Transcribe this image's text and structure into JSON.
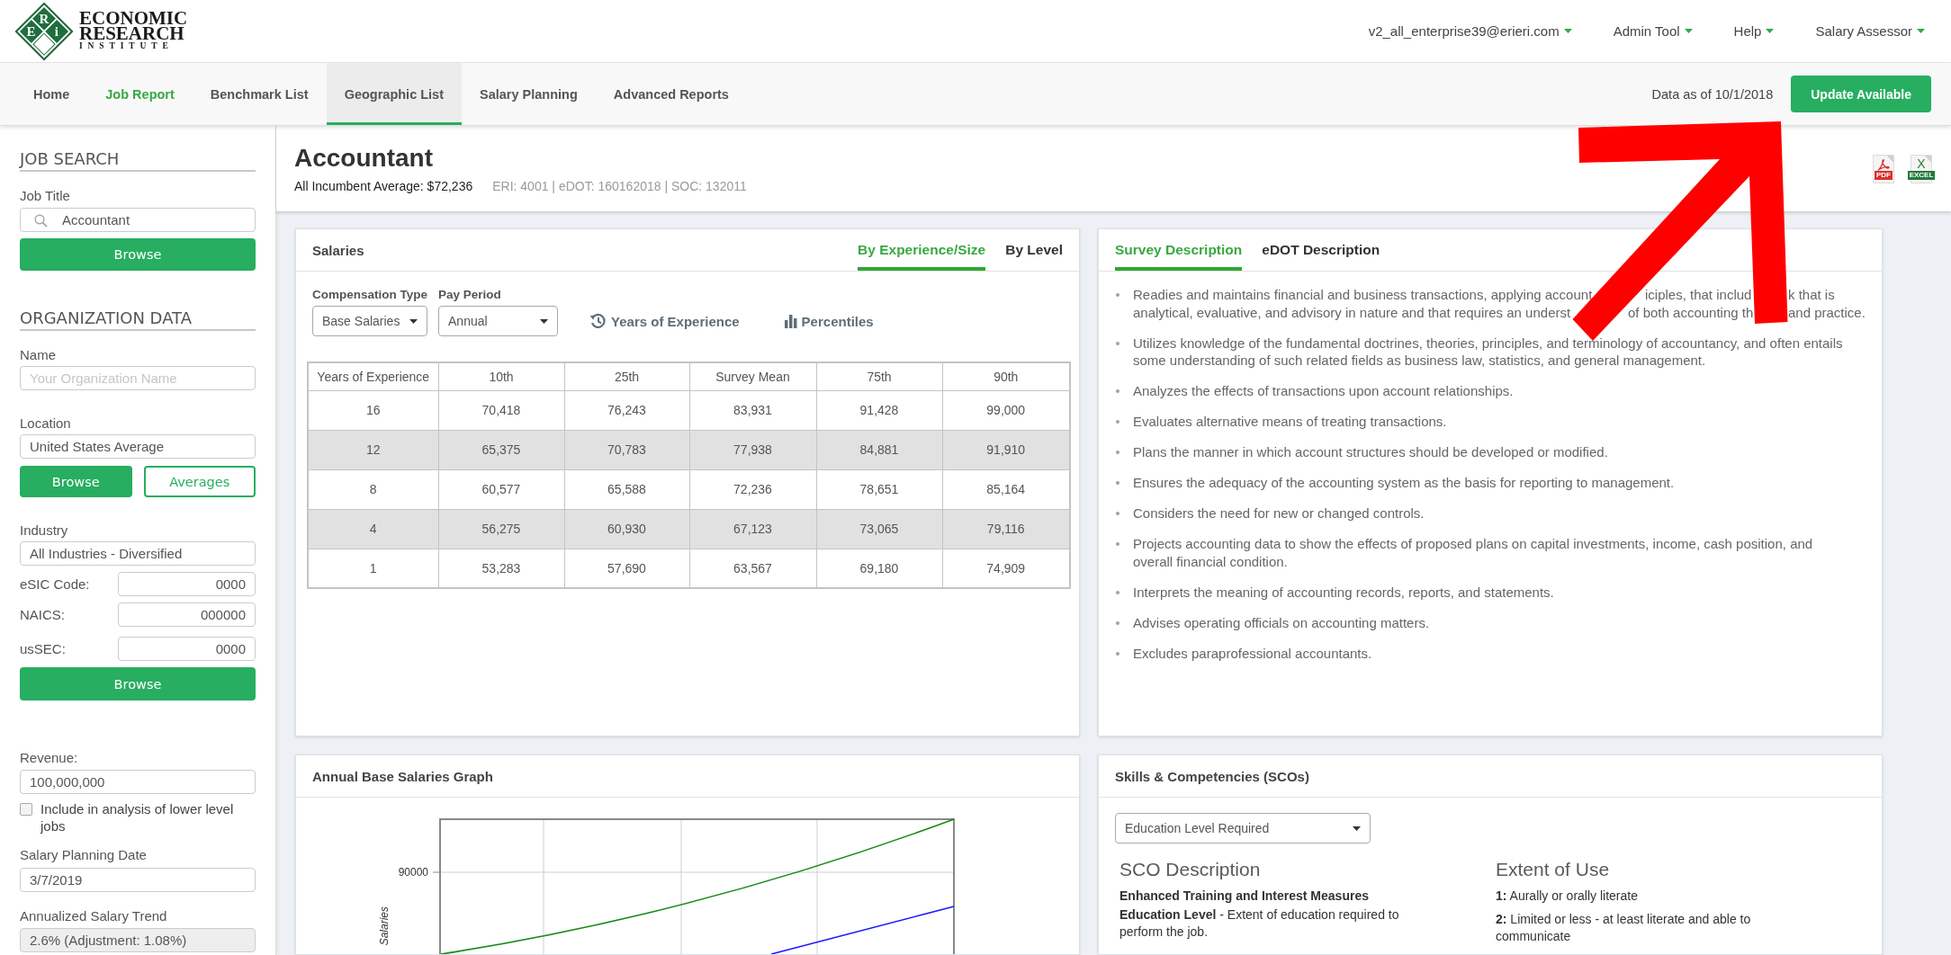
{
  "header": {
    "logo": {
      "tiles": [
        "R",
        "i",
        "E"
      ],
      "wordmark": [
        "ECONOMIC",
        "RESEARCH",
        "INSTITUTE"
      ]
    },
    "menus": [
      "v2_all_enterprise39@erieri.com",
      "Admin Tool",
      "Help",
      "Salary Assessor"
    ]
  },
  "nav": {
    "tabs": [
      {
        "label": "Home",
        "selected": false,
        "active": false
      },
      {
        "label": "Job Report",
        "selected": false,
        "active": true
      },
      {
        "label": "Benchmark List",
        "selected": false,
        "active": false
      },
      {
        "label": "Geographic List",
        "selected": true,
        "active": false
      },
      {
        "label": "Salary Planning",
        "selected": false,
        "active": false
      },
      {
        "label": "Advanced Reports",
        "selected": false,
        "active": false
      }
    ],
    "data_date": "Data as of 10/1/2018",
    "update_button": "Update Available"
  },
  "sidebar": {
    "job_search": {
      "heading": "JOB SEARCH",
      "job_title": {
        "label": "Job Title",
        "value": "Accountant"
      },
      "browse_button": "Browse"
    },
    "organization": {
      "heading": "ORGANIZATION DATA",
      "name": {
        "label": "Name",
        "placeholder": "Your Organization Name"
      },
      "location": {
        "label": "Location",
        "value": "United States Average"
      },
      "location_buttons": [
        {
          "label": "Browse",
          "kind": "primary"
        },
        {
          "label": "Averages",
          "kind": "outline"
        }
      ],
      "industry": {
        "label": "Industry",
        "value": "All Industries - Diversified"
      },
      "codes": [
        {
          "label": "eSIC Code:",
          "value": "0000"
        },
        {
          "label": "NAICS:",
          "value": "000000"
        },
        {
          "label": "usSEC:",
          "value": "0000"
        }
      ],
      "industry_browse_button": "Browse",
      "revenue": {
        "label": "Revenue:",
        "value": "100,000,000"
      },
      "lower_level": {
        "label": "Include in analysis of lower level jobs",
        "checked": false
      },
      "planning_date": {
        "label": "Salary Planning Date",
        "value": "3/7/2019"
      },
      "salary_trend": {
        "label": "Annualized Salary Trend",
        "value": "2.6% (Adjustment: 1.08%)",
        "disabled": true
      }
    }
  },
  "job": {
    "title": "Accountant",
    "average": "All Incumbent Average: $72,236",
    "codes": "ERI: 4001 | eDOT: 160162018 | SOC: 132011",
    "exports": [
      {
        "kind": "pdf",
        "label": "PDF"
      },
      {
        "kind": "excel",
        "glyph": "X",
        "label": "EXCEL"
      }
    ]
  },
  "salaries": {
    "title": "Salaries",
    "tabs": [
      {
        "label": "By Experience/Size",
        "selected": true
      },
      {
        "label": "By Level",
        "selected": false
      }
    ],
    "filters": [
      {
        "label": "Compensation Type",
        "value": "Base Salaries"
      },
      {
        "label": "Pay Period",
        "value": "Annual"
      }
    ],
    "toggles": [
      {
        "kind": "history",
        "label": "Years of Experience"
      },
      {
        "kind": "bars",
        "label": "Percentiles"
      }
    ],
    "table": {
      "columns": [
        "Years of Experience",
        "10th",
        "25th",
        "Survey Mean",
        "75th",
        "90th"
      ],
      "rows": [
        [
          "16",
          "70,418",
          "76,243",
          "83,931",
          "91,428",
          "99,000"
        ],
        [
          "12",
          "65,375",
          "70,783",
          "77,938",
          "84,881",
          "91,910"
        ],
        [
          "8",
          "60,577",
          "65,588",
          "72,236",
          "78,651",
          "85,164"
        ],
        [
          "4",
          "56,275",
          "60,930",
          "67,123",
          "73,065",
          "79,116"
        ],
        [
          "1",
          "53,283",
          "57,690",
          "63,567",
          "69,180",
          "74,909"
        ]
      ]
    }
  },
  "description": {
    "tabs": [
      {
        "label": "Survey Description",
        "selected": true
      },
      {
        "label": "eDOT Description",
        "selected": false
      }
    ],
    "items": [
      {
        "kind": "covered",
        "lines": [
          [
            "Readies and maintains financial and business transactions, applying account",
            "iciples, that includ",
            "k that is"
          ],
          [
            "analytical, evaluative, and advisory in nature and that requires an underst",
            "of both accounting th",
            "and practice."
          ]
        ]
      },
      {
        "kind": "text",
        "text": "Utilizes knowledge of the fundamental doctrines, theories, principles, and terminology of accountancy, and often entails some understanding of such related fields as business law, statistics, and general management."
      },
      {
        "kind": "text",
        "text": "Analyzes the effects of transactions upon account relationships."
      },
      {
        "kind": "text",
        "text": "Evaluates alternative means of treating transactions."
      },
      {
        "kind": "text",
        "text": "Plans the manner in which account structures should be developed or modified."
      },
      {
        "kind": "text",
        "text": "Ensures the adequacy of the accounting system as the basis for reporting to management."
      },
      {
        "kind": "text",
        "text": "Considers the need for new or changed controls."
      },
      {
        "kind": "text",
        "text": "Projects accounting data to show the effects of proposed plans on capital investments, income, cash position, and overall financial condition."
      },
      {
        "kind": "text",
        "text": "Interprets the meaning of accounting records, reports, and statements."
      },
      {
        "kind": "text",
        "text": "Advises operating officials on accounting matters."
      },
      {
        "kind": "text",
        "text": "Excludes paraprofessional accountants."
      }
    ]
  },
  "graph": {
    "title": "Annual Base Salaries Graph",
    "ytick": "90000",
    "ylabel": "Salaries"
  },
  "skills": {
    "title": "Skills & Competencies (SCOs)",
    "select": "Education Level Required",
    "sco": {
      "heading": "SCO Description",
      "subheading": "Enhanced Training and Interest Measures",
      "text": "**Education Level** - Extent of education required to perform the job."
    },
    "extent": {
      "heading": "Extent of Use",
      "items": [
        "**1:** Aurally or orally literate",
        "**2:** Limited or less - at least literate and able to communicate"
      ]
    }
  }
}
